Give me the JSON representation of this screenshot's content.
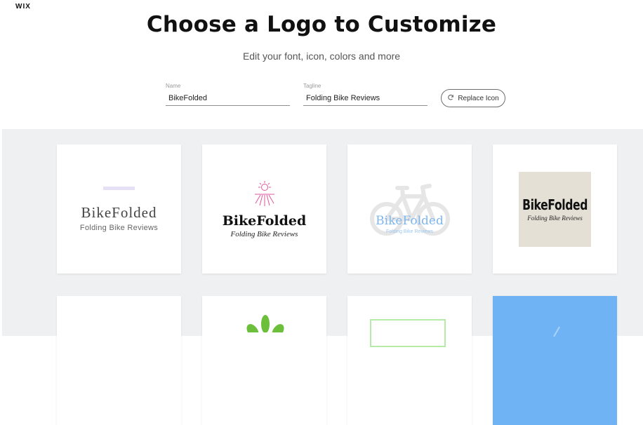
{
  "header": {
    "title": "Choose a Logo to Customize",
    "subtitle": "Edit your font, icon, colors and more"
  },
  "form": {
    "name_label": "Name",
    "name_value": "BikeFolded",
    "tagline_label": "Tagline",
    "tagline_value": "Folding Bike Reviews",
    "replace_icon_label": "Replace Icon"
  },
  "logos": [
    {
      "name": "BikeFolded",
      "tagline": "Folding Bike Reviews",
      "accent": "#e6e1f6"
    },
    {
      "name": "BikeFolded",
      "tagline": "Folding Bike Reviews",
      "icon": "sun-icon",
      "accent": "#e0559b"
    },
    {
      "name": "BikeFolded",
      "tagline": "Folding Bike Reviews",
      "icon": "bicycle-icon",
      "accent": "#7fb7ec"
    },
    {
      "name": "BikeFolded",
      "tagline": "Folding Bike Reviews",
      "accent": "#e5e0d6"
    },
    {
      "icon": "leaf-icon",
      "accent": "#6bbf3a"
    },
    {
      "accent": "#b5eaa8"
    },
    {
      "accent": "#6fb3f5"
    }
  ],
  "colors": {
    "background": "#eef0f2",
    "card": "#ffffff"
  }
}
